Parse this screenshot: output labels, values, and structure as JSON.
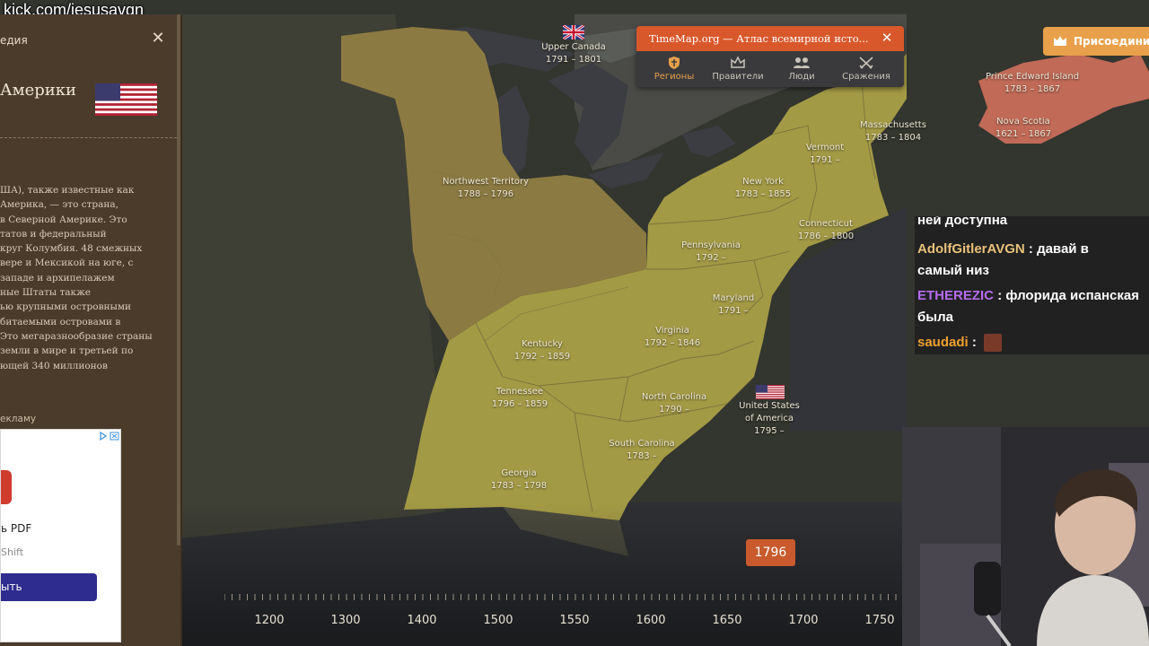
{
  "url_overlay": "kick.com/jesusavgn",
  "wiki_panel": {
    "title": "едия",
    "close_icon": "close-icon",
    "heading": "Америки",
    "flag_icon": "us-flag-icon",
    "text_lines": [
      "ША), также известные как",
      "Америка, — это страна,",
      "в Северной Америке. Это",
      "татов и федеральный",
      "круг Колумбия. 48 смежных",
      "вере и Мексикой на юге, с",
      "западе и архипелажем",
      "ные Штаты также",
      "ью крупными островными",
      "битаемыми островами в",
      "Это мегаразнообразие страны",
      "земли в мире и третьей по",
      "ющей 340 миллионов"
    ],
    "ad_label": "екламу",
    "ad": {
      "title": "ь PDF",
      "subtitle": "Shift",
      "button_label": "ыть"
    }
  },
  "popup": {
    "title": "TimeMap.org — Атлас всемирной исто...",
    "tabs": [
      {
        "label": "Регионы",
        "icon": "shield-icon",
        "active": true
      },
      {
        "label": "Правители",
        "icon": "crown-icon",
        "active": false
      },
      {
        "label": "Люди",
        "icon": "people-icon",
        "active": false
      },
      {
        "label": "Сражения",
        "icon": "crossed-swords-icon",
        "active": false
      }
    ]
  },
  "join_button": {
    "label": "Присоединий",
    "icon": "crown-icon"
  },
  "map_labels": {
    "upper_canada": {
      "name": "Upper Canada",
      "dates": "1791 – 1801"
    },
    "northwest_territory": {
      "name": "Northwest Territory",
      "dates": "1788 – 1796"
    },
    "vermont": {
      "name": "Vermont",
      "dates": "1791 –"
    },
    "massachusetts": {
      "name": "Massachusetts",
      "dates": "1783 – 1804"
    },
    "prince_edward_island": {
      "name": "Prince Edward Island",
      "dates": "1783 – 1867"
    },
    "nova_scotia": {
      "name": "Nova Scotia",
      "dates": "1621 – 1867"
    },
    "new_york": {
      "name": "New York",
      "dates": "1783 – 1855"
    },
    "connecticut": {
      "name": "Connecticut",
      "dates": "1786 – 1800"
    },
    "pennsylvania": {
      "name": "Pennsylvania",
      "dates": "1792 –"
    },
    "maryland": {
      "name": "Maryland",
      "dates": "1791 –"
    },
    "virginia": {
      "name": "Virginia",
      "dates": "1792 – 1846"
    },
    "kentucky": {
      "name": "Kentucky",
      "dates": "1792 – 1859"
    },
    "tennessee": {
      "name": "Tennessee",
      "dates": "1796 – 1859"
    },
    "north_carolina": {
      "name": "North Carolina",
      "dates": "1790 –"
    },
    "south_carolina": {
      "name": "South Carolina",
      "dates": "1783 –"
    },
    "georgia": {
      "name": "Georgia",
      "dates": "1783 – 1798"
    },
    "usa": {
      "name1": "United States",
      "name2": "of America",
      "dates": "1795 –"
    }
  },
  "chat": {
    "partial_top": "ней доступна",
    "messages": [
      {
        "user": "AdolfGitlerAVGN",
        "user_color": "#e8c27a",
        "text_line1": ": давай в",
        "text_line2": "самый низ"
      },
      {
        "user": "ETHEREZIC",
        "user_color": "#b56cf0",
        "text_line1": ": флорида испанская",
        "text_line2": "была"
      },
      {
        "user": "saudadi",
        "user_color": "#f0a030",
        "text_line1": ":",
        "emote": "emote-icon"
      }
    ]
  },
  "year_badge": "1796",
  "timeline": {
    "labels": [
      "1200",
      "1300",
      "1400",
      "1500",
      "1550",
      "1600",
      "1650",
      "1700",
      "1750"
    ]
  },
  "colors": {
    "usa_territory": "#a39a45",
    "northwest_territory": "#8b7a42",
    "british": "#c06a57",
    "water": "#3f4145",
    "accent": "#d9582b",
    "join": "#e8a04b"
  }
}
